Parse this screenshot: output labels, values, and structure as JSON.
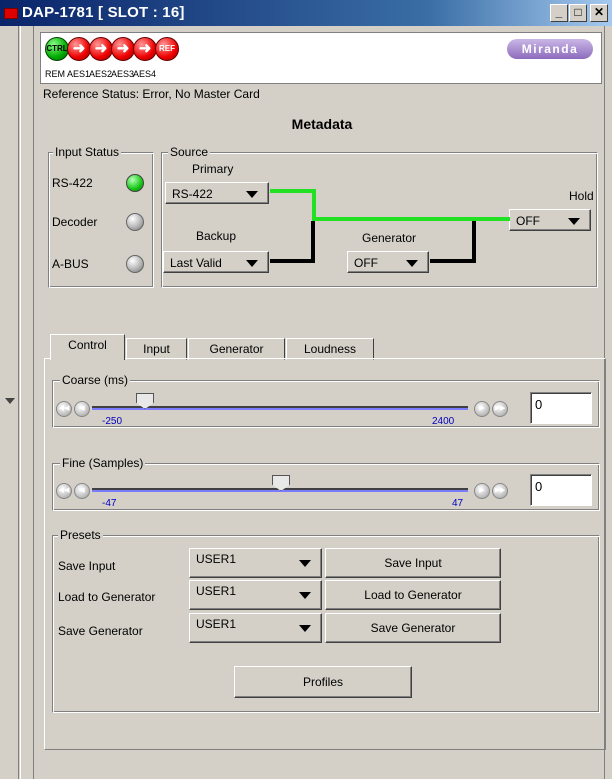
{
  "window": {
    "title": "DAP-1781 [ SLOT : 16]",
    "min_glyph": "_",
    "max_glyph": "□",
    "close_glyph": "✕"
  },
  "header": {
    "badges": [
      {
        "text": "CTRL",
        "color": "#00b000",
        "label": "REM"
      },
      {
        "text": "➜",
        "color": "#e00000",
        "label": "AES1"
      },
      {
        "text": "➜",
        "color": "#e00000",
        "label": "AES2"
      },
      {
        "text": "➜",
        "color": "#e00000",
        "label": "AES3"
      },
      {
        "text": "➜",
        "color": "#e00000",
        "label": "AES4"
      },
      {
        "text": "REF",
        "color": "#e00000",
        "label": ""
      }
    ],
    "logo": "Miranda"
  },
  "reference_status": "Reference Status: Error, No Master Card",
  "page_title": "Metadata",
  "input_status": {
    "legend": "Input Status",
    "items": [
      {
        "label": "RS-422",
        "state": "green"
      },
      {
        "label": "Decoder",
        "state": "gray"
      },
      {
        "label": "A-BUS",
        "state": "gray"
      }
    ]
  },
  "source": {
    "legend": "Source",
    "primary_label": "Primary",
    "primary_value": "RS-422",
    "backup_label": "Backup",
    "backup_value": "Last Valid",
    "generator_label": "Generator",
    "generator_value": "OFF",
    "hold_label": "Hold",
    "hold_value": "OFF",
    "active_path_color": "#22e022"
  },
  "tabs": [
    "Control",
    "Input",
    "Generator",
    "Loudness"
  ],
  "active_tab": "Control",
  "coarse": {
    "legend": "Coarse (ms)",
    "min": "-250",
    "max": "2400",
    "value": "0",
    "position_fraction": 0.0
  },
  "fine": {
    "legend": "Fine (Samples)",
    "min": "-47",
    "max": "47",
    "value": "0",
    "position_fraction": 0.5
  },
  "presets": {
    "legend": "Presets",
    "rows": [
      {
        "label": "Save Input",
        "select": "USER1",
        "button": "Save Input"
      },
      {
        "label": "Load to Generator",
        "select": "USER1",
        "button": "Load to Generator"
      },
      {
        "label": "Save Generator",
        "select": "USER1",
        "button": "Save Generator"
      }
    ],
    "profiles_button": "Profiles"
  }
}
